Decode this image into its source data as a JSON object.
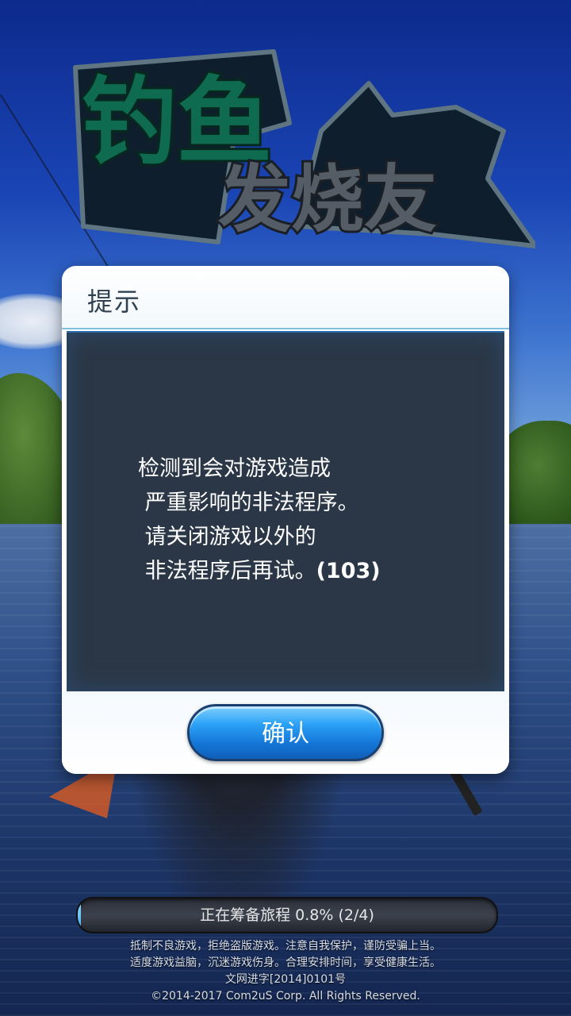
{
  "logo": {
    "line1": "钓鱼",
    "line2": "发烧友"
  },
  "dialog": {
    "title": "提示",
    "message_lines": [
      "检测到会对游戏造成",
      " 严重影响的非法程序。",
      " 请关闭游戏以外的",
      " 非法程序后再试。"
    ],
    "error_code": "(103)",
    "confirm_label": "确认"
  },
  "loading": {
    "text": "正在筹备旅程 0.8% (2/4)",
    "progress_fraction": 0.008
  },
  "legal": {
    "line1": "抵制不良游戏，拒绝盗版游戏。注意自我保护，谨防受骗上当。",
    "line2": "适度游戏益脑，沉迷游戏伤身。合理安排时间，享受健康生活。",
    "line3": "文网进字[2014]0101号",
    "line4": "©2014-2017 Com2uS Corp. All Rights Reserved."
  },
  "colors": {
    "button_blue": "#1577d8",
    "dialog_border": "#7fc0dc",
    "logo_green": "#0f6b50"
  }
}
